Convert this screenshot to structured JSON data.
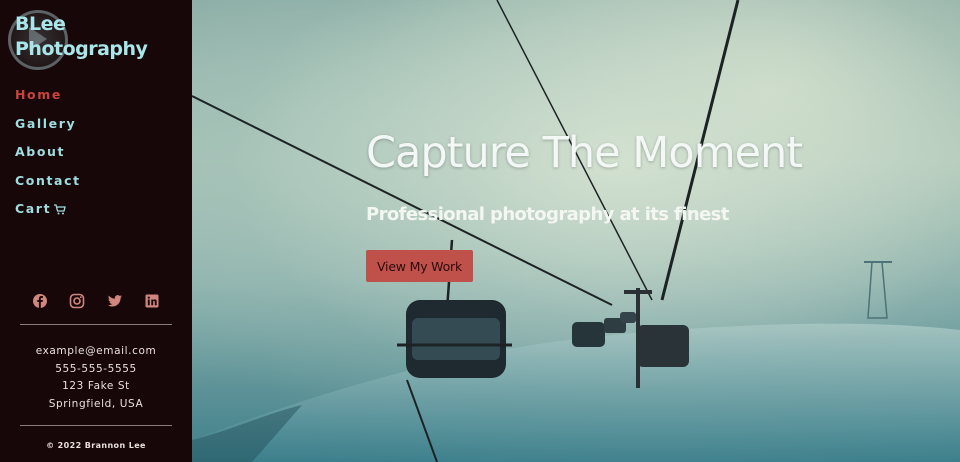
{
  "brand": {
    "name": "BLee\nPhotography"
  },
  "nav": {
    "items": [
      {
        "label": "Home",
        "active": true
      },
      {
        "label": "Gallery"
      },
      {
        "label": "About"
      },
      {
        "label": "Contact"
      },
      {
        "label": "Cart",
        "icon": "cart-icon"
      }
    ]
  },
  "socials": [
    "facebook-icon",
    "instagram-icon",
    "twitter-icon",
    "linkedin-icon"
  ],
  "contact": {
    "email": "example@email.com",
    "phone": "555-555-5555",
    "street": "123 Fake St",
    "city": "Springfield, USA"
  },
  "copyright": "© 2022 Brannon Lee",
  "hero": {
    "title": "Capture The Moment",
    "subtitle": "Professional photography at its finest",
    "button": "View My Work"
  },
  "colors": {
    "sidebar_bg": "#170708",
    "nav_text": "#9fdde0",
    "nav_active": "#c9443a",
    "button_bg": "#c0514a"
  }
}
